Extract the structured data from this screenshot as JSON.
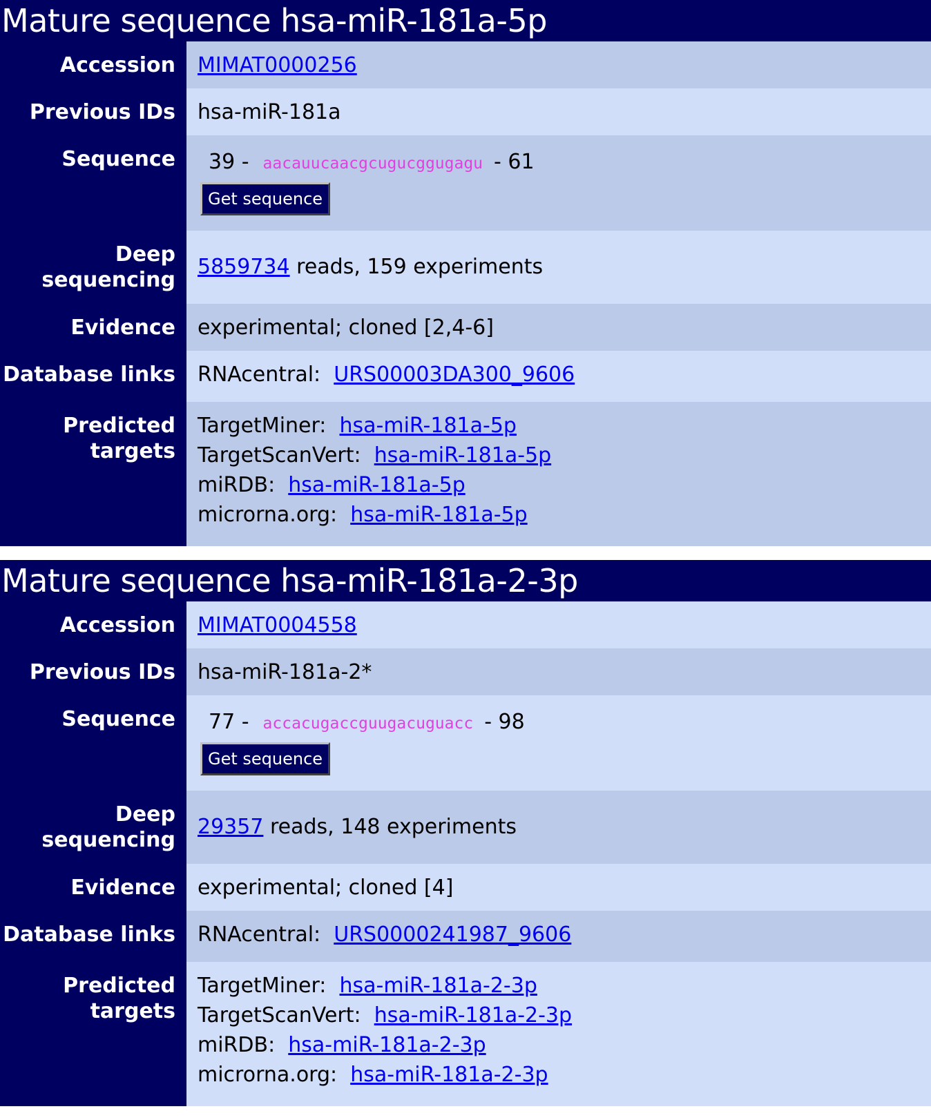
{
  "sections": [
    {
      "title": "Mature sequence hsa-miR-181a-5p",
      "labels": {
        "accession": "Accession",
        "previous_ids": "Previous IDs",
        "sequence": "Sequence",
        "deep_seq_1": "Deep",
        "deep_seq_2": "sequencing",
        "evidence": "Evidence",
        "database_links": "Database links",
        "predicted_1": "Predicted",
        "predicted_2": "targets"
      },
      "accession": "MIMAT0000256",
      "previous_ids": "hsa-miR-181a",
      "seq_start": "39 -",
      "sequence": "aacauucaacgcugucggugagu",
      "seq_end": "- 61",
      "get_sequence_label": "Get sequence",
      "deep_seq_reads_link": "5859734",
      "deep_seq_text": " reads, 159 experiments",
      "evidence": "experimental; cloned [2,4-6]",
      "db_link_label": "RNAcentral:",
      "db_link": "URS00003DA300_9606",
      "targets": [
        {
          "label": "TargetMiner:",
          "link": "hsa-miR-181a-5p"
        },
        {
          "label": "TargetScanVert:",
          "link": "hsa-miR-181a-5p"
        },
        {
          "label": "miRDB:",
          "link": "hsa-miR-181a-5p"
        },
        {
          "label": "microrna.org:",
          "link": "hsa-miR-181a-5p"
        }
      ]
    },
    {
      "title": "Mature sequence hsa-miR-181a-2-3p",
      "labels": {
        "accession": "Accession",
        "previous_ids": "Previous IDs",
        "sequence": "Sequence",
        "deep_seq_1": "Deep",
        "deep_seq_2": "sequencing",
        "evidence": "Evidence",
        "database_links": "Database links",
        "predicted_1": "Predicted",
        "predicted_2": "targets"
      },
      "accession": "MIMAT0004558",
      "previous_ids": "hsa-miR-181a-2*",
      "seq_start": "77 -",
      "sequence": "accacugaccguugacuguacc",
      "seq_end": "- 98",
      "get_sequence_label": "Get sequence",
      "deep_seq_reads_link": "29357",
      "deep_seq_text": " reads, 148 experiments",
      "evidence": "experimental; cloned [4]",
      "db_link_label": "RNAcentral:",
      "db_link": "URS0000241987_9606",
      "targets": [
        {
          "label": "TargetMiner:",
          "link": "hsa-miR-181a-2-3p"
        },
        {
          "label": "TargetScanVert:",
          "link": "hsa-miR-181a-2-3p"
        },
        {
          "label": "miRDB:",
          "link": "hsa-miR-181a-2-3p"
        },
        {
          "label": "microrna.org:",
          "link": "hsa-miR-181a-2-3p"
        }
      ]
    }
  ]
}
